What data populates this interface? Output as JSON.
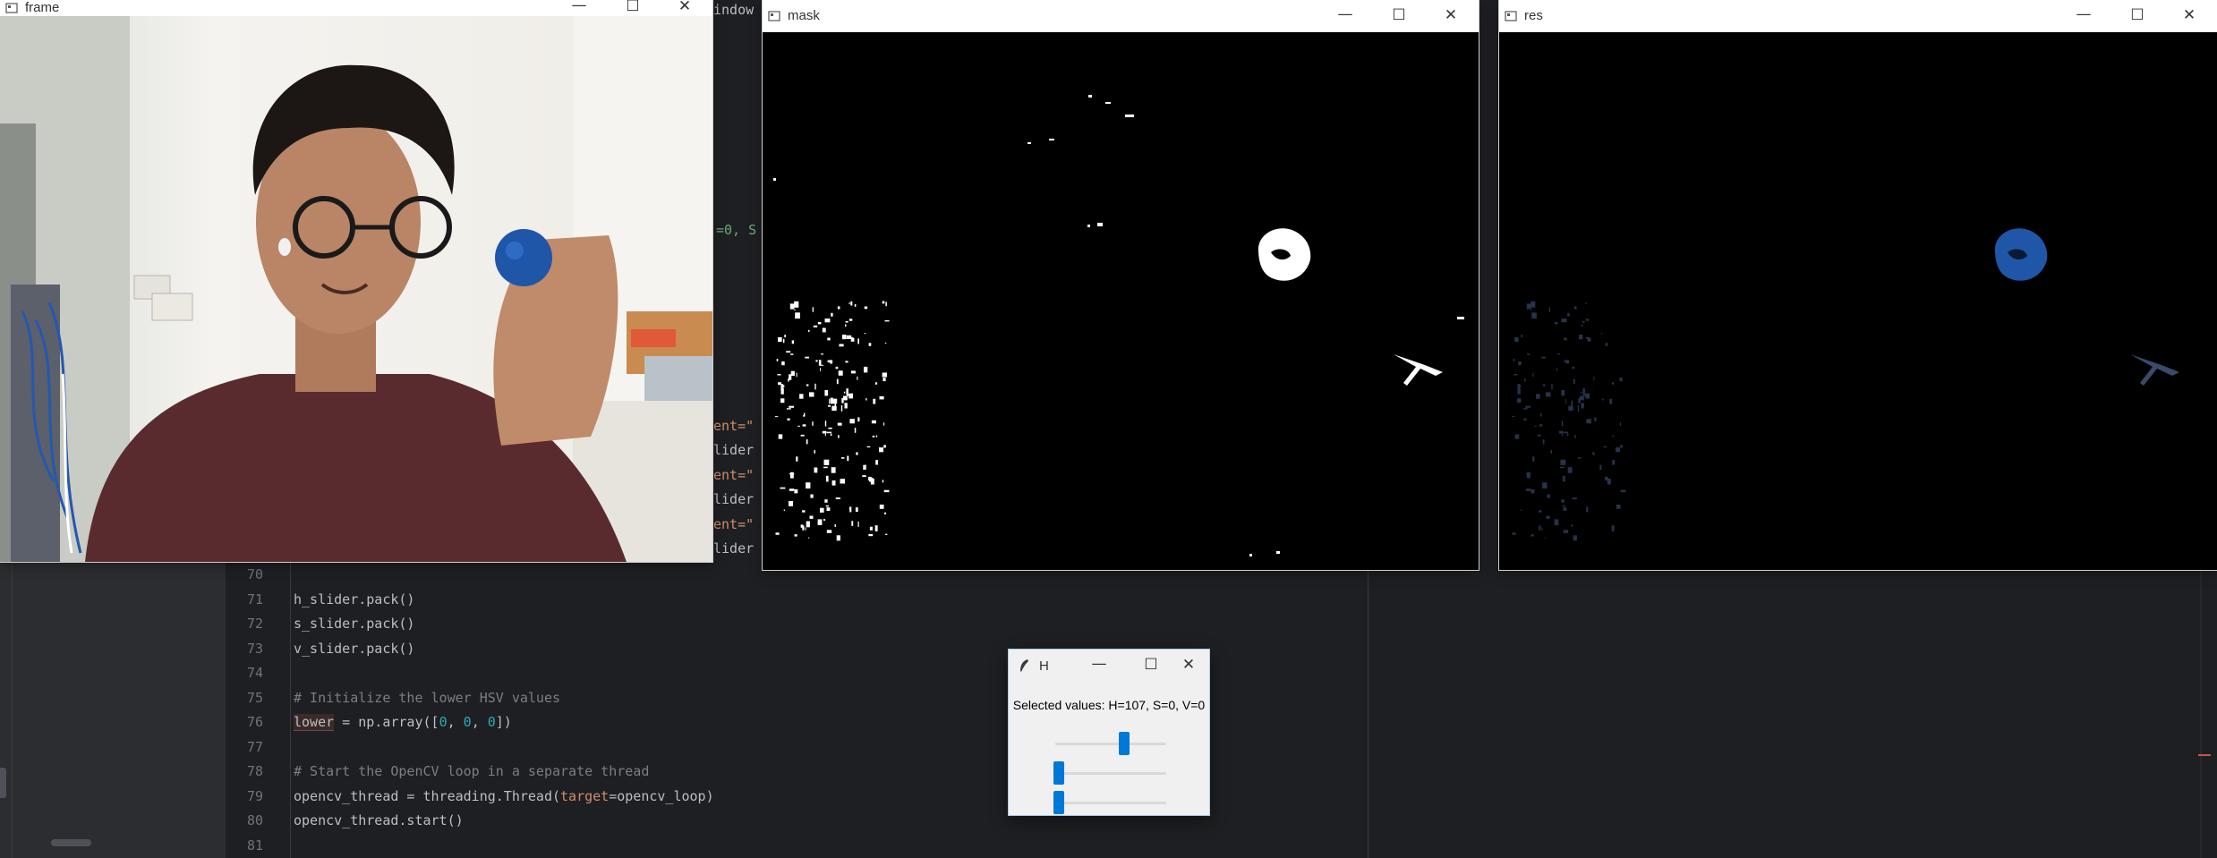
{
  "windows": {
    "frame": {
      "title": "frame"
    },
    "mask": {
      "title": "mask"
    },
    "res": {
      "title": "res"
    }
  },
  "caption_buttons": {
    "minimize": "—",
    "maximize": "☐",
    "close": "✕"
  },
  "peek_text": {
    "top": "indow",
    "mid": "=0, S",
    "l1": "ent=\"",
    "l2": "lider",
    "l3": "ent=\"",
    "l4": "lider",
    "l5": "ent=\"",
    "l6": "lider"
  },
  "code": {
    "lines": [
      {
        "n": "70",
        "parts": []
      },
      {
        "n": "71",
        "parts": [
          {
            "t": "h_slider.pack()",
            "c": ""
          }
        ]
      },
      {
        "n": "72",
        "parts": [
          {
            "t": "s_slider.pack()",
            "c": ""
          }
        ]
      },
      {
        "n": "73",
        "parts": [
          {
            "t": "v_slider.pack()",
            "c": ""
          }
        ]
      },
      {
        "n": "74",
        "parts": []
      },
      {
        "n": "75",
        "parts": [
          {
            "t": "# Initialize the lower HSV values",
            "c": "cmt"
          }
        ]
      },
      {
        "n": "76",
        "parts": [
          {
            "t": "lower",
            "c": "hl"
          },
          {
            "t": " = np.array([",
            "c": ""
          },
          {
            "t": "0",
            "c": "num"
          },
          {
            "t": ", ",
            "c": ""
          },
          {
            "t": "0",
            "c": "num"
          },
          {
            "t": ", ",
            "c": ""
          },
          {
            "t": "0",
            "c": "num"
          },
          {
            "t": "])",
            "c": ""
          }
        ]
      },
      {
        "n": "77",
        "parts": []
      },
      {
        "n": "78",
        "parts": [
          {
            "t": "# Start the OpenCV loop in a separate thread",
            "c": "cmt"
          }
        ]
      },
      {
        "n": "79",
        "parts": [
          {
            "t": "opencv_thread = threading.Thread(",
            "c": ""
          },
          {
            "t": "target",
            "c": "kw"
          },
          {
            "t": "=opencv_loop)",
            "c": ""
          }
        ]
      },
      {
        "n": "80",
        "parts": [
          {
            "t": "opencv_thread.start()",
            "c": ""
          }
        ]
      },
      {
        "n": "81",
        "parts": []
      }
    ]
  },
  "dialog": {
    "title": "H",
    "selected_text": "Selected values: H=107, S=0, V=0",
    "sliders": [
      {
        "name": "h",
        "value": 107,
        "max": 179
      },
      {
        "name": "s",
        "value": 0,
        "max": 255
      },
      {
        "name": "v",
        "value": 0,
        "max": 255
      }
    ]
  },
  "colors": {
    "slider_thumb": "#0078d7",
    "blue_ball": "#1f56a8",
    "ide_bg": "#1e1f22"
  }
}
